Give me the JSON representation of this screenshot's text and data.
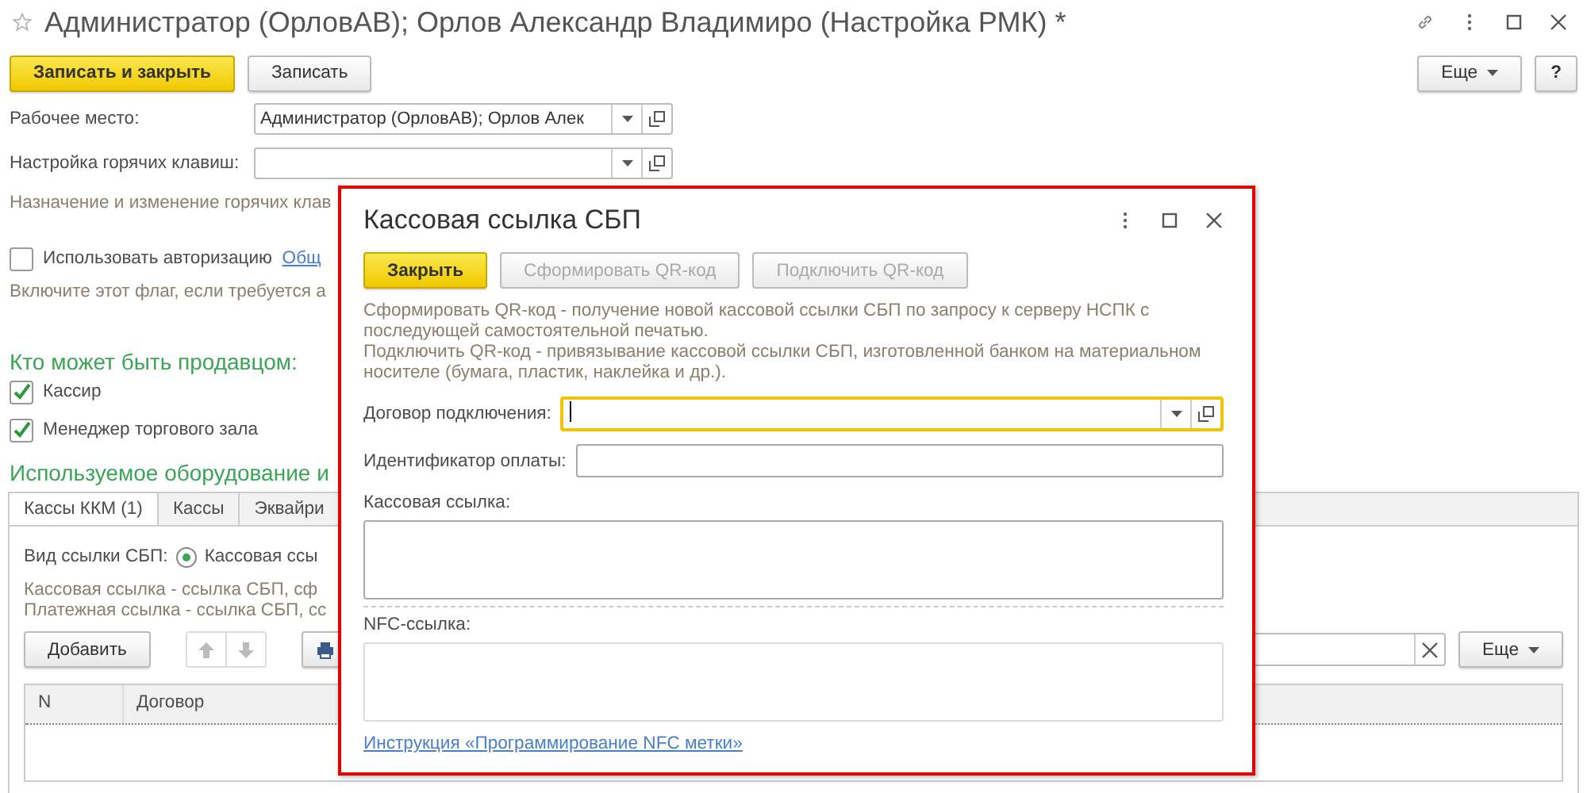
{
  "window": {
    "title": "Администратор (ОрловАВ); Орлов Александр Владимиро (Настройка РМК) *"
  },
  "toolbar": {
    "buttons": [
      {
        "label": "Записать и закрыть",
        "kind": "primary"
      },
      {
        "label": "Записать",
        "kind": "normal"
      }
    ],
    "more": "Еще",
    "help": "?"
  },
  "fields": [
    {
      "label": "Рабочее место:",
      "value": "Администратор (ОрловАВ); Орлов Алек"
    },
    {
      "label": "Настройка горячих клавиш:"
    }
  ],
  "hotkeys_hint": "Назначение и изменение горячих клав",
  "authorization": {
    "label": "Использовать авторизацию",
    "checked": false,
    "link": "Общ",
    "hint": "Включите этот флаг, если требуется а"
  },
  "sellers": {
    "title": "Кто может быть продавцом:",
    "items": [
      {
        "label": "Кассир",
        "checked": true
      },
      {
        "label": "Менеджер торгового зала",
        "checked": true
      }
    ]
  },
  "equipment": {
    "title": "Используемое оборудование и",
    "tabs": [
      {
        "label": "Кассы ККМ (1)",
        "selected": true
      },
      {
        "label": "Кассы",
        "selected": false
      },
      {
        "label": "Эквайри",
        "selected": false
      }
    ],
    "link_type": {
      "label": "Вид ссылки СБП:",
      "option": "Кассовая ссы",
      "selected": true
    },
    "hints": [
      "Кассовая ссылка - ссылка СБП, сф",
      "Платежная ссылка - ссылка СБП, сс"
    ],
    "toolbar": {
      "add": "Добавить",
      "more": "Еще"
    },
    "table": {
      "columns": [
        "N",
        "Договор"
      ]
    }
  },
  "dialog": {
    "title": "Кассовая ссылка СБП",
    "buttons": [
      {
        "label": "Закрыть",
        "kind": "primary",
        "disabled": false
      },
      {
        "label": "Сформировать QR-код",
        "kind": "normal",
        "disabled": true
      },
      {
        "label": "Подключить QR-код",
        "kind": "normal",
        "disabled": true
      }
    ],
    "description": [
      "Сформировать QR-код - получение новой кассовой ссылки СБП по запросу к серверу НСПК с последующей самостоятельной печатью.",
      "Подключить QR-код - привязывание кассовой ссылки СБП, изготовленной банком на материальном носителе (бумага, пластик, наклейка и др.)."
    ],
    "contract": {
      "label": "Договор подключения:",
      "focused": true
    },
    "payment_id": {
      "label": "Идентификатор оплаты:"
    },
    "cash_link": {
      "label": "Кассовая ссылка:"
    },
    "nfc_link": {
      "label": "NFC-ссылка:"
    },
    "link": "Инструкция «Программирование NFC метки»"
  }
}
